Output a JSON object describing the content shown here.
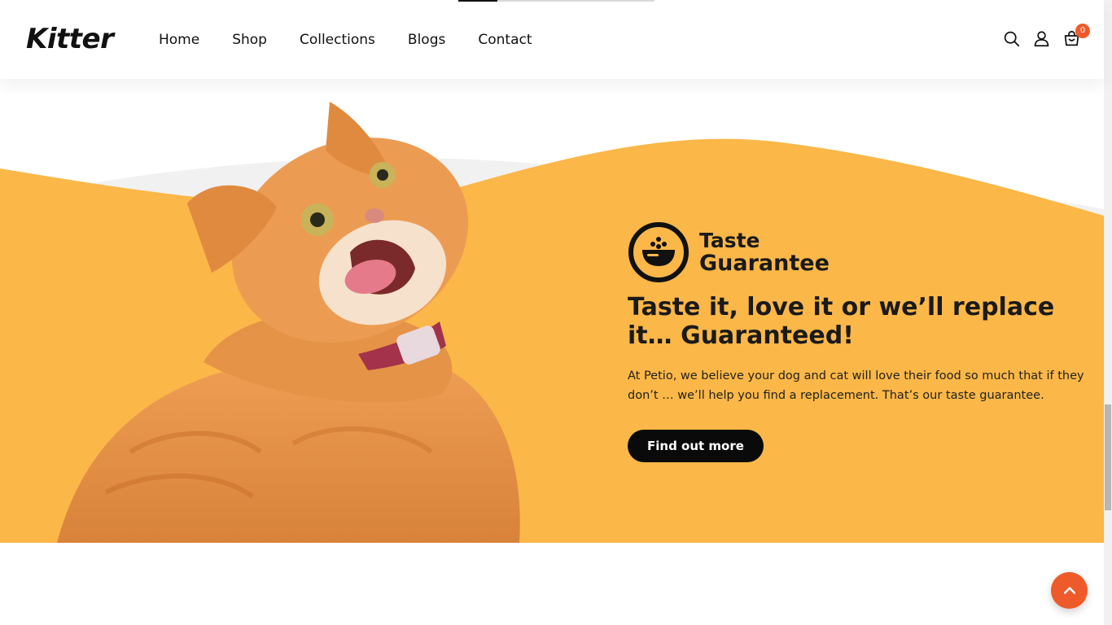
{
  "header": {
    "logo": "Kitter",
    "nav": [
      {
        "label": "Home"
      },
      {
        "label": "Shop"
      },
      {
        "label": "Collections"
      },
      {
        "label": "Blogs"
      },
      {
        "label": "Contact"
      }
    ],
    "icons": [
      "search-icon",
      "user-icon",
      "cart-icon"
    ],
    "cart_count": "0",
    "scroll_progress": 0.2
  },
  "hero": {
    "badge": {
      "line1": "Taste",
      "line2": "Guarantee",
      "icon": "food-bowl-icon"
    },
    "heading": "Taste it, love it or we’ll replace it… Guaranteed!",
    "description": "At Petio, we believe your dog and cat will love their food so much that if they don’t … we’ll help you find a replacement. That’s our taste guarantee.",
    "button_label": "Find out more"
  },
  "colors": {
    "accent_yellow": "#fbb748",
    "accent_orange": "#ef5a2a",
    "wave_grey": "#f1f1f1",
    "text_dark": "#1a1a1a"
  },
  "floating": {
    "back_to_top_icon": "chevron-up-icon"
  }
}
